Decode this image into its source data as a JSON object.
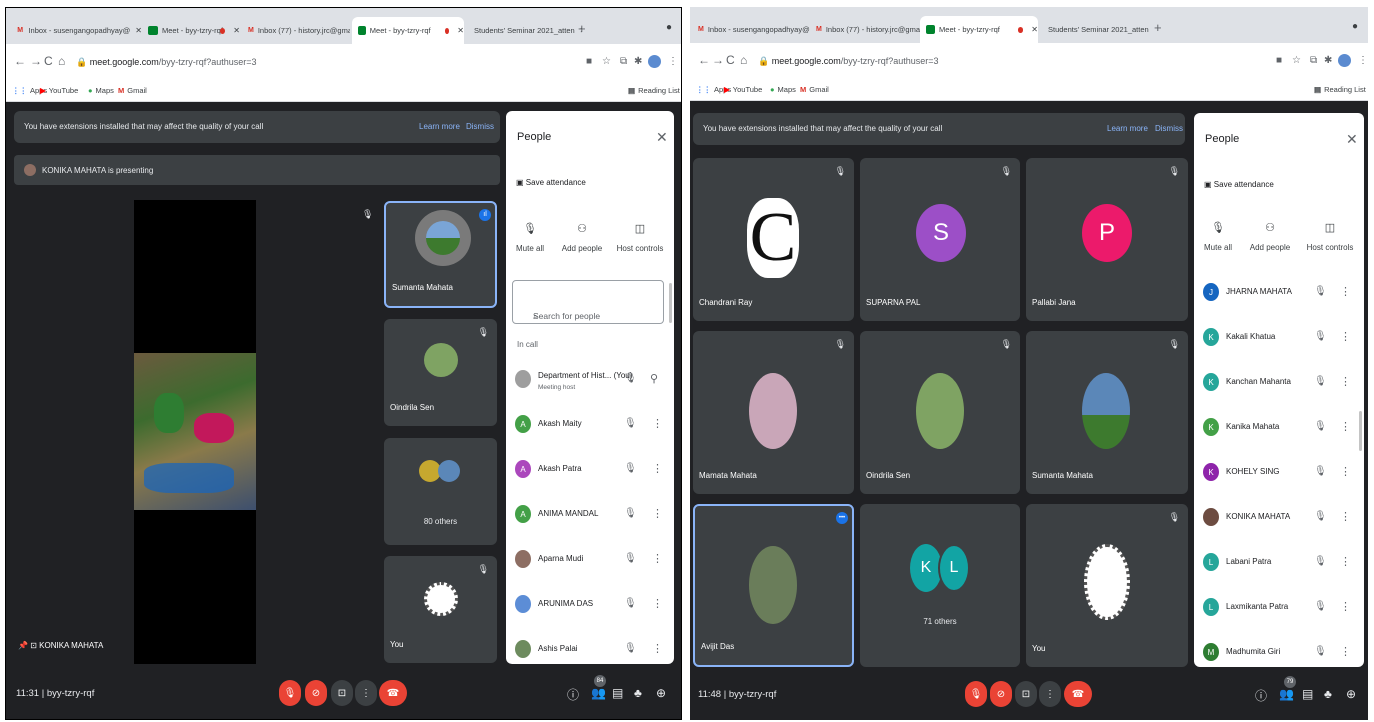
{
  "colors": {
    "meet_bg": "#202124",
    "tile_bg": "#3c4043",
    "accent_blue": "#8ab4f8",
    "end_call_red": "#ea4335",
    "panel_bg": "#ffffff"
  },
  "left": {
    "tabs": [
      {
        "label": "Inbox - susengangopadhyay@",
        "icon": "gmail-icon"
      },
      {
        "label": "Meet - byy-tzry-rqf",
        "icon": "meet-icon"
      },
      {
        "label": "Inbox (77) - history.jrc@gmail",
        "icon": "gmail-icon"
      },
      {
        "label": "Meet - byy-tzry-rqf",
        "icon": "meet-icon"
      },
      {
        "label": "Students' Seminar 2021_atten",
        "icon": "sheets-icon"
      }
    ],
    "url": {
      "host": "meet.google.com",
      "path": "/byy-tzry-rqf?authuser=3"
    },
    "bookmarks": [
      "Apps",
      "YouTube",
      "Maps",
      "Gmail"
    ],
    "reading_list": "Reading List",
    "banner": {
      "text": "You have extensions installed that may affect the quality of your call",
      "learn_more": "Learn more",
      "dismiss": "Dismiss"
    },
    "presenting": "KONIKA MAHATA is presenting",
    "presenter_name": "KONIKA MAHATA",
    "tiles": [
      {
        "name": "Sumanta Mahata"
      },
      {
        "name": "Oindrila Sen"
      },
      {
        "name": "80 others"
      },
      {
        "name": "You"
      }
    ],
    "clock": "11:31",
    "meeting_code": "byy-tzry-rqf",
    "participants_badge": "84",
    "people": {
      "title": "People",
      "save_attendance": "Save attendance",
      "actions": [
        "Mute all",
        "Add people",
        "Host controls"
      ],
      "search_placeholder": "Search for people",
      "in_call": "In call",
      "list": [
        {
          "name": "Department of Hist... (You)",
          "sub": "Meeting host",
          "initial": "",
          "color": "#9e9e9e"
        },
        {
          "name": "Akash Maity",
          "initial": "A",
          "color": "#43a047"
        },
        {
          "name": "Akash Patra",
          "initial": "A",
          "color": "#ab47bc"
        },
        {
          "name": "ANIMA MANDAL",
          "initial": "A",
          "color": "#43a047"
        },
        {
          "name": "Aparna Mudi",
          "initial": "",
          "color": "#8d6e63"
        },
        {
          "name": "ARUNIMA DAS",
          "initial": "",
          "color": "#5c8dd6"
        },
        {
          "name": "Ashis Palai",
          "initial": "",
          "color": "#6d8b5e"
        }
      ]
    }
  },
  "right": {
    "tabs": [
      {
        "label": "Inbox - susengangopadhyay@",
        "icon": "gmail-icon"
      },
      {
        "label": "Inbox (77) - history.jrc@gmail",
        "icon": "gmail-icon"
      },
      {
        "label": "Meet - byy-tzry-rqf",
        "icon": "meet-icon"
      },
      {
        "label": "Students' Seminar 2021_atten",
        "icon": "sheets-icon"
      }
    ],
    "url": {
      "host": "meet.google.com",
      "path": "/byy-tzry-rqf?authuser=3"
    },
    "bookmarks": [
      "Apps",
      "YouTube",
      "Maps",
      "Gmail"
    ],
    "reading_list": "Reading List",
    "banner": {
      "text": "You have extensions installed that may affect the quality of your call",
      "learn_more": "Learn more",
      "dismiss": "Dismiss"
    },
    "tiles": [
      {
        "name": "Chandrani Ray",
        "initial": "C",
        "color": "#ffffff"
      },
      {
        "name": "SUPARNA PAL",
        "initial": "S",
        "color": "#9c4fc7"
      },
      {
        "name": "Pallabi Jana",
        "initial": "P",
        "color": "#ec1a6b"
      },
      {
        "name": "Mamata Mahata",
        "initial": "",
        "color": "#c9a6b8"
      },
      {
        "name": "Oindrila Sen",
        "initial": "",
        "color": "#7fa363"
      },
      {
        "name": "Sumanta Mahata",
        "initial": "",
        "color": "#5b87b8"
      },
      {
        "name": "Avijit Das",
        "initial": "",
        "color": "#6a7d5a"
      },
      {
        "name": "71 others",
        "initials": [
          "K",
          "L"
        ],
        "color": "#12a4a4"
      },
      {
        "name": "You",
        "initial": "",
        "color": "#ffffff"
      }
    ],
    "clock": "11:48",
    "meeting_code": "byy-tzry-rqf",
    "participants_badge": "79",
    "people": {
      "title": "People",
      "save_attendance": "Save attendance",
      "actions": [
        "Mute all",
        "Add people",
        "Host controls"
      ],
      "list": [
        {
          "name": "JHARNA MAHATA",
          "initial": "J",
          "color": "#1565c0"
        },
        {
          "name": "Kakali Khatua",
          "initial": "K",
          "color": "#26a69a"
        },
        {
          "name": "Kanchan Mahanta",
          "initial": "K",
          "color": "#26a69a"
        },
        {
          "name": "Kanika Mahata",
          "initial": "K",
          "color": "#43a047"
        },
        {
          "name": "KOHELY SING",
          "initial": "K",
          "color": "#8e24aa"
        },
        {
          "name": "KONIKA MAHATA",
          "initial": "",
          "color": "#6d4c41"
        },
        {
          "name": "Labani Patra",
          "initial": "L",
          "color": "#26a69a"
        },
        {
          "name": "Laxmikanta Patra",
          "initial": "L",
          "color": "#26a69a"
        },
        {
          "name": "Madhumita Giri",
          "initial": "M",
          "color": "#2e7d32"
        }
      ]
    }
  }
}
